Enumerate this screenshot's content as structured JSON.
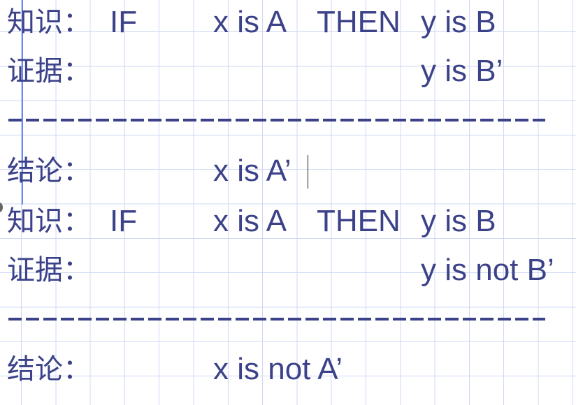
{
  "colors": {
    "text": "#3c4289",
    "grid": "#cfd8f4",
    "guide": "#6c86f2"
  },
  "block1": {
    "knowledge_label": "知识：",
    "if": "IF",
    "antecedent": "x is A",
    "then": "THEN",
    "consequent": "y is B",
    "evidence_label": "证据：",
    "evidence": "y is B’",
    "separator": "----------------------------------------",
    "conclusion_label": "结论：",
    "conclusion": "x is A’"
  },
  "block2": {
    "knowledge_label": "知识：",
    "if": "IF",
    "antecedent": "x is A",
    "then": "THEN",
    "consequent": "y is B",
    "evidence_label": "证据：",
    "evidence": "y is not B’",
    "separator": "----------------------------------------",
    "conclusion_label": "结论：",
    "conclusion": "x is not A’"
  }
}
